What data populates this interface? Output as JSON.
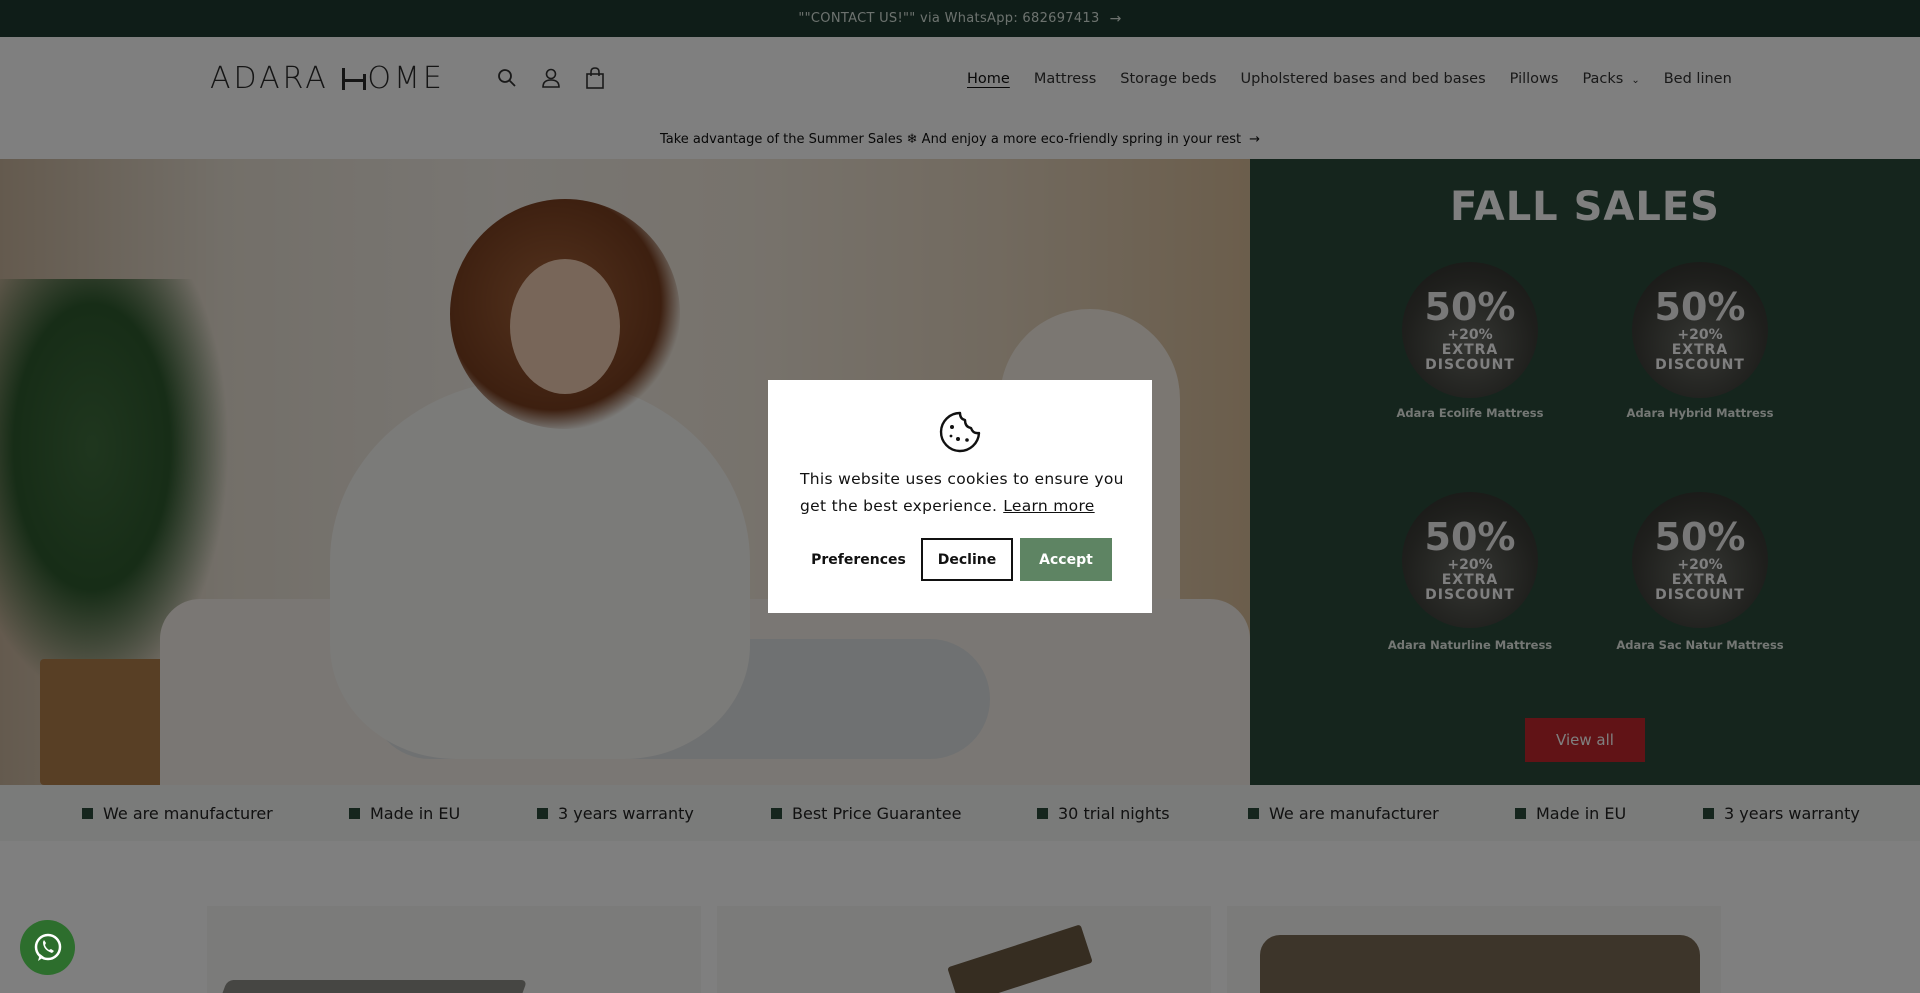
{
  "announcement": {
    "text": "\"\"CONTACT US!\"\" via WhatsApp: 682697413",
    "arrow": "→"
  },
  "header": {
    "logo_text_left": "ADARA",
    "logo_text_right": "OME",
    "icons": [
      "search-icon",
      "account-icon",
      "cart-icon"
    ],
    "nav": [
      {
        "label": "Home",
        "active": true
      },
      {
        "label": "Mattress"
      },
      {
        "label": "Storage beds"
      },
      {
        "label": "Upholstered bases and bed bases"
      },
      {
        "label": "Pillows"
      },
      {
        "label": "Packs",
        "has_dropdown": true
      },
      {
        "label": "Bed linen"
      }
    ]
  },
  "promo": {
    "text": "Take advantage of the Summer Sales ❄ And enjoy a more eco-friendly spring in your rest",
    "arrow": "→"
  },
  "sales": {
    "title": "FALL SALES",
    "products": [
      {
        "name": "Adara Ecolife Mattress",
        "percent": "50%",
        "extra_percent": "+20%",
        "extra_line1": "EXTRA",
        "extra_line2": "DISCOUNT"
      },
      {
        "name": "Adara Hybrid Mattress",
        "percent": "50%",
        "extra_percent": "+20%",
        "extra_line1": "EXTRA",
        "extra_line2": "DISCOUNT"
      },
      {
        "name": "Adara Naturline Mattress",
        "percent": "50%",
        "extra_percent": "+20%",
        "extra_line1": "EXTRA",
        "extra_line2": "DISCOUNT"
      },
      {
        "name": "Adara Sac Natur Mattress",
        "percent": "50%",
        "extra_percent": "+20%",
        "extra_line1": "EXTRA",
        "extra_line2": "DISCOUNT"
      }
    ],
    "view_all": "View all"
  },
  "features": [
    "We are manufacturer",
    "Made in EU",
    "3 years warranty",
    "Best Price Guarantee",
    "30 trial nights",
    "We are manufacturer",
    "Made in EU",
    "3 years warranty"
  ],
  "cookie": {
    "message": "This website uses cookies to ensure you get the best experience.",
    "learn_more": "Learn more",
    "preferences": "Preferences",
    "decline": "Decline",
    "accept": "Accept"
  },
  "colors": {
    "brand_dark_green": "#1f3a30",
    "accept_green": "#5e8463",
    "view_all_red": "#c2262c"
  }
}
